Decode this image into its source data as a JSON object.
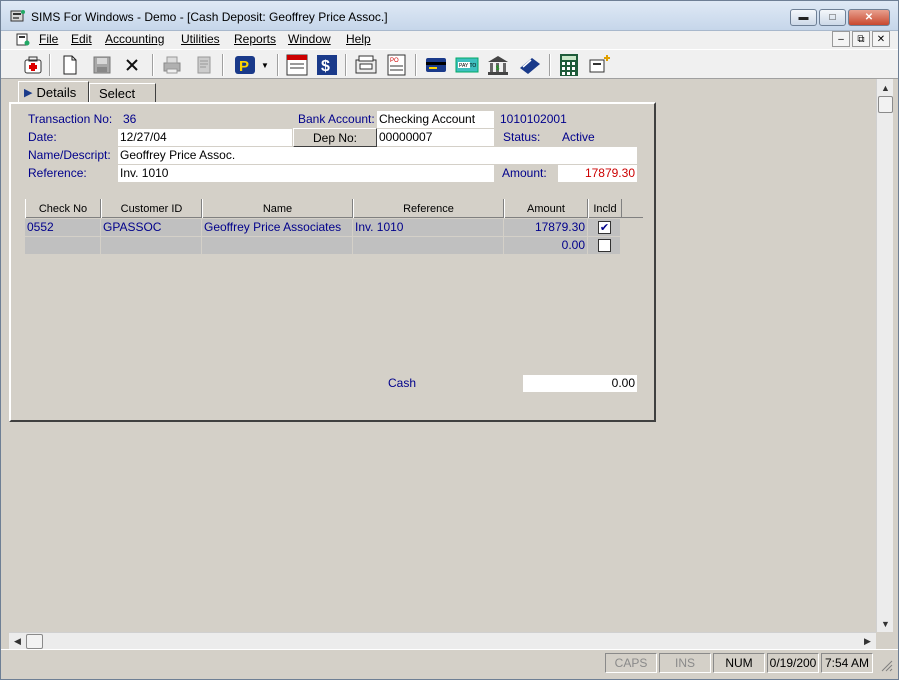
{
  "window": {
    "title": "SIMS For Windows - Demo - [Cash Deposit: Geoffrey Price Assoc.]"
  },
  "menu": {
    "items": [
      {
        "label": "File"
      },
      {
        "label": "Edit"
      },
      {
        "label": "Accounting"
      },
      {
        "label": "Utilities"
      },
      {
        "label": "Reports"
      },
      {
        "label": "Window"
      },
      {
        "label": "Help"
      }
    ]
  },
  "tabs": {
    "details": "Details",
    "select": "Select"
  },
  "form": {
    "transaction_no_label": "Transaction No:",
    "transaction_no": "36",
    "bank_account_label": "Bank Account:",
    "bank_account": "Checking Account",
    "bank_account_no": "1010102001",
    "date_label": "Date:",
    "date": "12/27/04",
    "dep_no_button": "Dep No:",
    "dep_no": "00000007",
    "status_label": "Status:",
    "status": "Active",
    "name_label": "Name/Descript:",
    "name": "Geoffrey Price Assoc.",
    "reference_label": "Reference:",
    "reference": "Inv. 1010",
    "amount_label": "Amount:",
    "amount": "17879.30",
    "cash_label": "Cash",
    "cash": "0.00",
    "amount_color": "#cc0000"
  },
  "grid": {
    "headers": [
      "Check No",
      "Customer ID",
      "Name",
      "Reference",
      "Amount",
      "Incld"
    ],
    "rows": [
      {
        "check_no": "0552",
        "customer_id": "GPASSOC",
        "name": "Geoffrey Price Associates",
        "reference": "Inv. 1010",
        "amount": "17879.30",
        "included": true
      },
      {
        "check_no": "",
        "customer_id": "",
        "name": "",
        "reference": "",
        "amount": "0.00",
        "included": false
      }
    ]
  },
  "status_bar": {
    "caps": "CAPS",
    "ins": "INS",
    "num": "NUM",
    "date": "0/19/200",
    "time": "7:54 AM"
  },
  "toolbar": {
    "icons": [
      "new-record-icon",
      "new-document-icon",
      "save-icon",
      "delete-icon",
      "print-icon",
      "print-preview-icon",
      "payment-icon",
      "invoice-icon",
      "dollar-icon",
      "register-icon",
      "purchase-order-icon",
      "credit-card-icon",
      "pay-to-check-icon",
      "bank-icon",
      "deposit-icon",
      "calculator-icon",
      "pay-icon"
    ]
  }
}
